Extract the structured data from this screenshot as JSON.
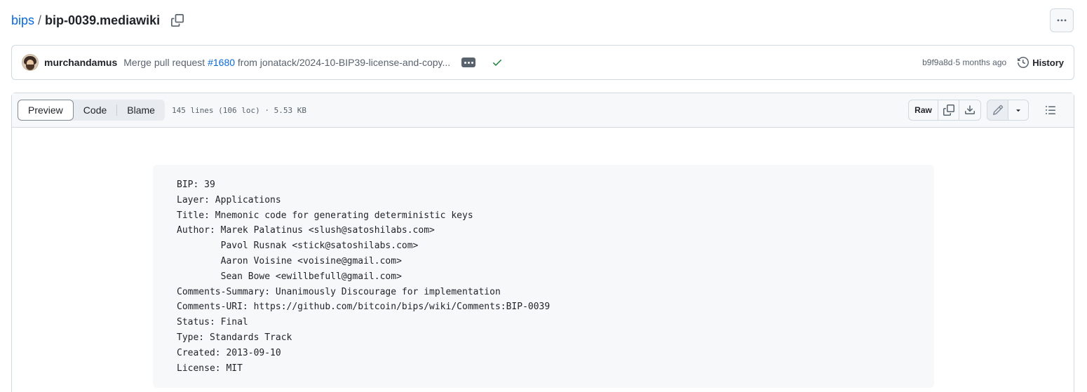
{
  "breadcrumb": {
    "repo": "bips",
    "separator": "/",
    "file": "bip-0039.mediawiki"
  },
  "commit": {
    "author": "murchandamus",
    "message_prefix": "Merge pull request ",
    "pr_link": "#1680",
    "message_suffix": " from jonatack/2024-10-BIP39-license-and-copy...",
    "sha": "b9f9a8d",
    "separator": " · ",
    "age": "5 months ago",
    "history_label": "History"
  },
  "file_header": {
    "tabs": [
      "Preview",
      "Code",
      "Blame"
    ],
    "active_tab": "Preview",
    "meta": "145 lines (106 loc) · 5.53 KB",
    "raw_label": "Raw"
  },
  "preamble": "BIP: 39\nLayer: Applications\nTitle: Mnemonic code for generating deterministic keys\nAuthor: Marek Palatinus <slush@satoshilabs.com>\n        Pavol Rusnak <stick@satoshilabs.com>\n        Aaron Voisine <voisine@gmail.com>\n        Sean Bowe <ewillbefull@gmail.com>\nComments-Summary: Unanimously Discourage for implementation\nComments-URI: https://github.com/bitcoin/bips/wiki/Comments:BIP-0039\nStatus: Final\nType: Standards Track\nCreated: 2013-09-10\nLicense: MIT",
  "icons": {
    "copy": "copy-icon",
    "kebab": "kebab-horizontal-icon",
    "check": "check-icon",
    "history": "history-icon",
    "download": "download-icon",
    "pencil": "pencil-icon",
    "caret": "triangle-down-icon",
    "outline": "list-unordered-icon"
  },
  "colors": {
    "link": "#0969da",
    "success": "#1a7f37",
    "muted": "#59636e"
  }
}
